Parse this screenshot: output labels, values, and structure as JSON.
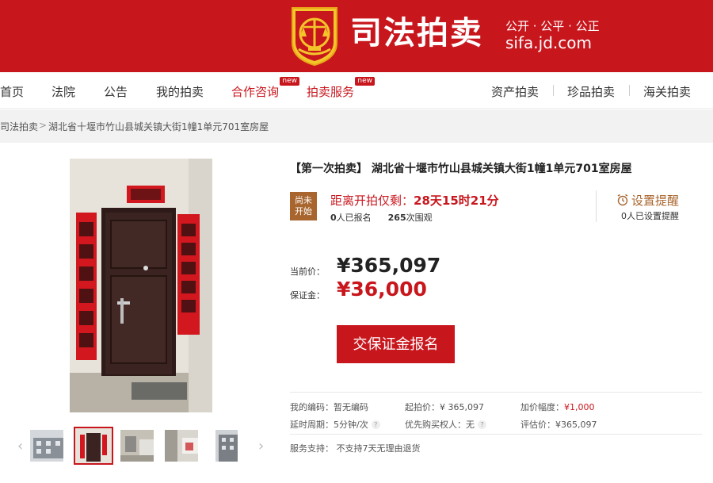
{
  "header": {
    "brand_title": "司法拍卖",
    "slogan": "公开 · 公平 · 公正",
    "domain": "sifa.jd.com"
  },
  "nav": {
    "left": [
      {
        "label": "首页"
      },
      {
        "label": "法院"
      },
      {
        "label": "公告"
      },
      {
        "label": "我的拍卖"
      },
      {
        "label": "合作咨询",
        "badge": "new"
      },
      {
        "label": "拍卖服务",
        "badge": "new"
      }
    ],
    "right": [
      {
        "label": "资产拍卖"
      },
      {
        "label": "珍品拍卖"
      },
      {
        "label": "海关拍卖"
      }
    ]
  },
  "breadcrumb": {
    "root": "司法拍卖",
    "separator": ">",
    "current": "湖北省十堰市竹山县城关镇大街1幢1单元701室房屋"
  },
  "item": {
    "title": "【第一次拍卖】 湖北省十堰市竹山县城关镇大街1幢1单元701室房屋",
    "status": "尚未开始",
    "countdown_label": "距离开拍仅剩：",
    "countdown_value": "28天15时21分",
    "signup_count": "0",
    "signup_suffix": "人已报名",
    "views_count": "265",
    "views_suffix": "次围观",
    "remind_label": "设置提醒",
    "remind_count": "0人已设置提醒",
    "current_price_label": "当前价：",
    "current_price": "¥365,097",
    "deposit_label": "保证金：",
    "deposit": "¥36,000",
    "cta_label": "交保证金报名"
  },
  "meta": {
    "code_label": "我的编码：",
    "code_value": "暂无编码",
    "start_label": "起拍价：",
    "start_value": "¥ 365,097",
    "increment_label": "加价幅度：",
    "increment_value": "¥1,000",
    "delay_label": "延时周期：",
    "delay_value": "5分钟/次",
    "priority_label": "优先购买权人：",
    "priority_value": "无",
    "estimate_label": "评估价：",
    "estimate_value": "¥365,097",
    "service_label": "服务支持：",
    "service_value": "不支持7天无理由退货"
  },
  "colors": {
    "brand_red": "#c8161d",
    "status_brown": "#a8652e"
  }
}
